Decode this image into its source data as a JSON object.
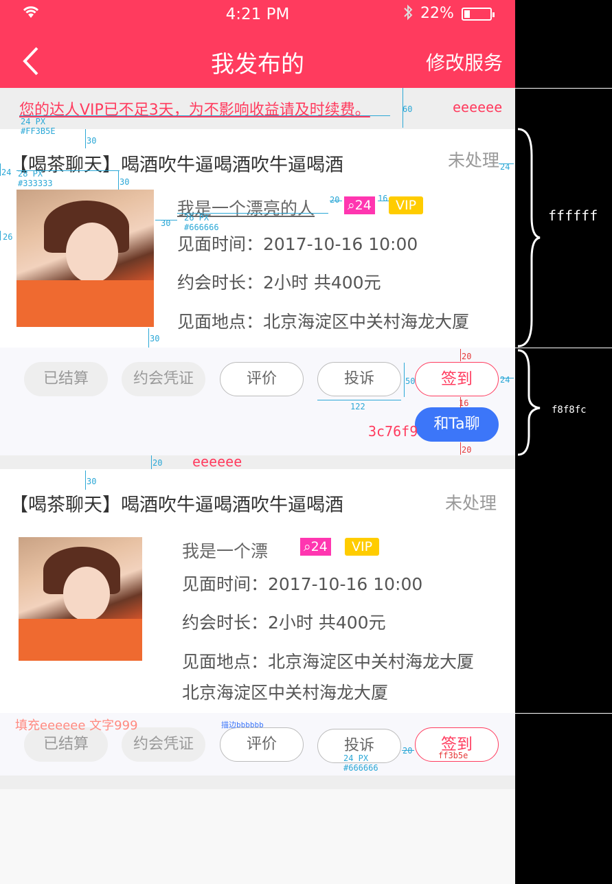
{
  "status": {
    "time": "4:21 PM",
    "battery": "22%",
    "battery_level": 0.22
  },
  "nav": {
    "title": "我发布的",
    "right": "修改服务"
  },
  "notice": {
    "text": "您的达人VIP已不足3天，为不影响收益请及时续费。"
  },
  "cards": [
    {
      "title": "【喝茶聊天】喝酒吹牛逼喝酒吹牛逼喝酒",
      "state": "未处理",
      "name": "我是一个漂亮的人",
      "level": "24",
      "vip": "VIP",
      "time": "见面时间：2017-10-16  10:00",
      "duration": "约会时长：2小时  共400元",
      "place": "见面地点：北京海淀区中关村海龙大厦",
      "place2": "",
      "buttons": [
        "已结算",
        "约会凭证",
        "评价",
        "投诉",
        "签到"
      ],
      "chat": "和Ta聊"
    },
    {
      "title": "【喝茶聊天】喝酒吹牛逼喝酒吹牛逼喝酒",
      "state": "未处理",
      "name": "我是一个漂",
      "level": "24",
      "vip": "VIP",
      "time": "见面时间：2017-10-16  10:00",
      "duration": "约会时长：2小时  共400元",
      "place": "见面地点：北京海淀区中关村海龙大厦",
      "place2": "北京海淀区中关村海龙大厦",
      "buttons": [
        "已结算",
        "约会凭证",
        "评价",
        "投诉",
        "签到"
      ]
    }
  ],
  "annotations": {
    "notice_h": "60",
    "notice_font": "24 PX",
    "notice_color": "#FF3B5E",
    "gap30a": "30",
    "title_font": "28 PX",
    "title_color": "#333333",
    "left24": "24",
    "gap30b": "30",
    "right24": "24",
    "name_gap20": "20",
    "name_gap16": "16",
    "photo_gap30": "30",
    "name_font": "26 PX",
    "name_color": "#666666",
    "left26": "26",
    "bottom30": "30",
    "btn_top20": "20",
    "btn_h50": "50",
    "btn_right24": "24",
    "btn_w122": "122",
    "btn_gap16": "16",
    "btn_bottom20": "20",
    "chat_color": "3c76f9",
    "gap20": "20",
    "eeeeee_notice": "eeeeee",
    "eeeeee_gap": "eeeeee",
    "card_bg": "ffffff",
    "action_bg": "f8f8fc",
    "card2_top30": "30",
    "fill_note": "填充eeeeee  文字999",
    "stroke_note": "描边bbbbbb",
    "btn_font": "24 PX",
    "btn_color": "#666666",
    "btn_spacing": "20",
    "sign_color": "ff3b5e"
  }
}
